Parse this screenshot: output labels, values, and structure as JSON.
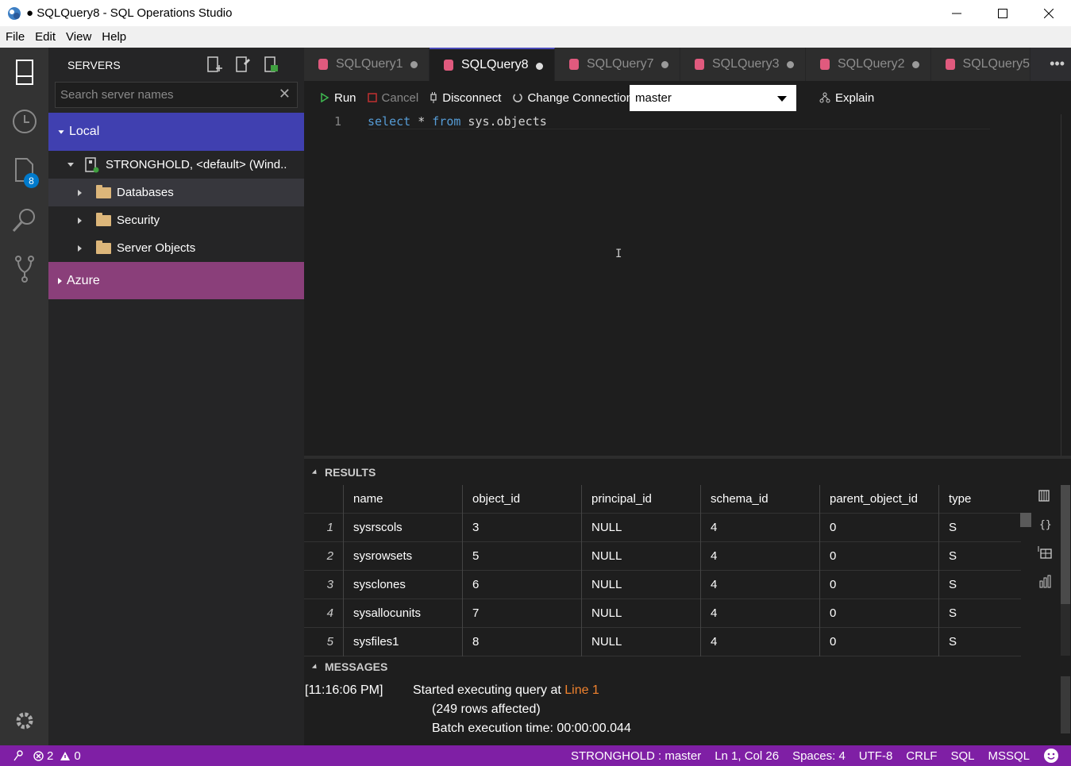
{
  "window": {
    "title": "● SQLQuery8 - SQL Operations Studio"
  },
  "menu": [
    "File",
    "Edit",
    "View",
    "Help"
  ],
  "activity_bar": {
    "badge_count": "8"
  },
  "sidebar": {
    "header": "SERVERS",
    "search_placeholder": "Search server names",
    "local_group": "Local",
    "server_label": "STRONGHOLD, <default> (Wind..",
    "folders": [
      "Databases",
      "Security",
      "Server Objects"
    ],
    "azure_group": "Azure"
  },
  "tabs": [
    {
      "label": "SQLQuery1",
      "active": false
    },
    {
      "label": "SQLQuery8",
      "active": true
    },
    {
      "label": "SQLQuery7",
      "active": false
    },
    {
      "label": "SQLQuery3",
      "active": false
    },
    {
      "label": "SQLQuery2",
      "active": false
    },
    {
      "label": "SQLQuery5",
      "active": false
    }
  ],
  "toolbar": {
    "run": "Run",
    "cancel": "Cancel",
    "disconnect": "Disconnect",
    "change_connection": "Change Connection",
    "database": "master",
    "explain": "Explain"
  },
  "editor": {
    "line_number": "1",
    "kw_select": "select",
    "star": " * ",
    "kw_from": "from",
    "object": " sys.objects"
  },
  "results": {
    "header": "RESULTS",
    "columns": [
      "name",
      "object_id",
      "principal_id",
      "schema_id",
      "parent_object_id",
      "type"
    ],
    "rows": [
      [
        "1",
        "sysrscols",
        "3",
        "NULL",
        "4",
        "0",
        "S"
      ],
      [
        "2",
        "sysrowsets",
        "5",
        "NULL",
        "4",
        "0",
        "S"
      ],
      [
        "3",
        "sysclones",
        "6",
        "NULL",
        "4",
        "0",
        "S"
      ],
      [
        "4",
        "sysallocunits",
        "7",
        "NULL",
        "4",
        "0",
        "S"
      ],
      [
        "5",
        "sysfiles1",
        "8",
        "NULL",
        "4",
        "0",
        "S"
      ]
    ]
  },
  "messages": {
    "header": "MESSAGES",
    "timestamp": "[11:16:06 PM]",
    "started": "Started executing query at ",
    "line_link": "Line 1",
    "rows_affected": "(249 rows affected)",
    "batch_time": "Batch execution time: 00:00:00.044"
  },
  "status_bar": {
    "errors": "2",
    "warnings": "0",
    "connection": "STRONGHOLD : master",
    "position": "Ln 1, Col 26",
    "spaces": "Spaces: 4",
    "encoding": "UTF-8",
    "eol": "CRLF",
    "language": "SQL",
    "provider": "MSSQL"
  },
  "colors": {
    "status_bar": "#7f1fa5",
    "local_group": "#4040b0",
    "azure_group": "#8a3f7a",
    "line_link": "#f0822e",
    "accent": "#007acc"
  }
}
